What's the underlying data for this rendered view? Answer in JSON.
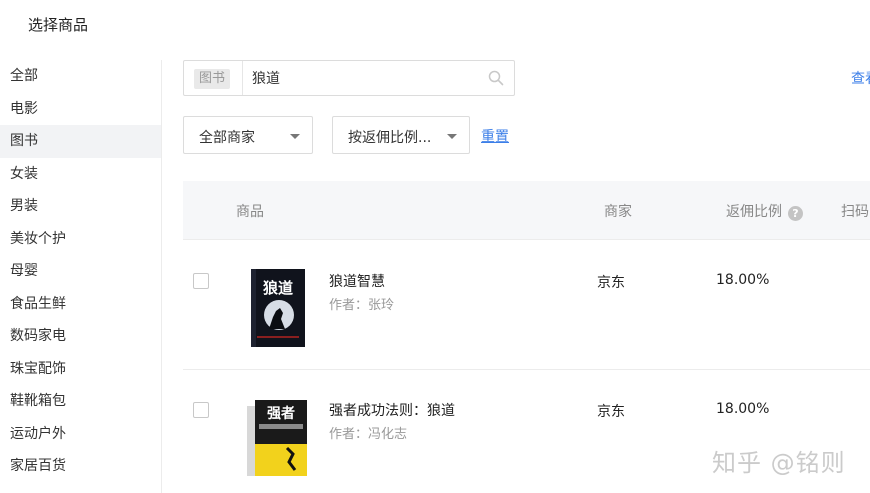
{
  "header": {
    "title": "选择商品"
  },
  "sidebar": {
    "items": [
      {
        "label": "全部"
      },
      {
        "label": "电影"
      },
      {
        "label": "图书",
        "active": true
      },
      {
        "label": "女装"
      },
      {
        "label": "男装"
      },
      {
        "label": "美妆个护"
      },
      {
        "label": "母婴"
      },
      {
        "label": "食品生鲜"
      },
      {
        "label": "数码家电"
      },
      {
        "label": "珠宝配饰"
      },
      {
        "label": "鞋靴箱包"
      },
      {
        "label": "运动户外"
      },
      {
        "label": "家居百货"
      }
    ]
  },
  "search": {
    "tag": "图书",
    "value": "狼道",
    "icon": "search-icon"
  },
  "toolbar": {
    "view_link": "查看"
  },
  "filters": {
    "merchant_select": "全部商家",
    "sort_select": "按返佣比例...",
    "reset_label": "重置"
  },
  "table": {
    "headers": {
      "product": "商品",
      "merchant": "商家",
      "ratio": "返佣比例",
      "scan": "扫码"
    },
    "rows": [
      {
        "title": "狼道智慧",
        "author_label": "作者：",
        "author": "张玲",
        "merchant": "京东",
        "ratio": "18.00%",
        "cover_title": "狼道"
      },
      {
        "title": "强者成功法则：狼道",
        "author_label": "作者：",
        "author": "冯化志",
        "merchant": "京东",
        "ratio": "18.00%",
        "cover_title": "强者"
      }
    ]
  },
  "watermark": "知乎 @铭则",
  "colors": {
    "link": "#3d7fe8",
    "active_bg": "#f2f3f5",
    "header_bg": "#f6f7f9"
  }
}
